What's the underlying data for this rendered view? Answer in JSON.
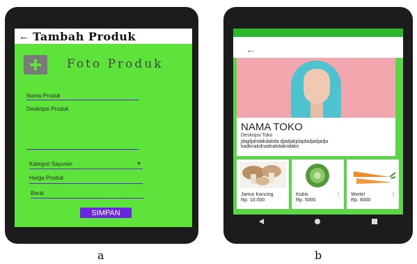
{
  "phone_a": {
    "title": "Tambah Produk",
    "back_glyph": "←",
    "photo_label": "Foto Produk",
    "fields": {
      "name": "Nama Produk",
      "description": "Deskripsi Produk",
      "category": "Kategori Sayuran",
      "price": "Harga Produk",
      "weight": "Berat"
    },
    "save_label": "SIMPAN",
    "colors": {
      "background": "#5ee33b",
      "accent": "#6a27e0"
    }
  },
  "phone_b": {
    "back_glyph": "←",
    "shop_name": "NAMA TOKO",
    "shop_description_label": "Deskripsi Toko",
    "shop_description_text": "jdajdjahdakdakda djadjakjdajdadjadjadja kadknakdnadnakdakndakn",
    "products": [
      {
        "name": "Jamur  Kancing",
        "price": "Rp. 10.000"
      },
      {
        "name": "Kubis",
        "price": "Rp. 5000"
      },
      {
        "name": "Wortel",
        "price": "Rp. 8000"
      }
    ],
    "colors": {
      "frame": "#5ed44a",
      "status": "#2bb82b"
    }
  },
  "captions": {
    "a": "a",
    "b": "b"
  }
}
